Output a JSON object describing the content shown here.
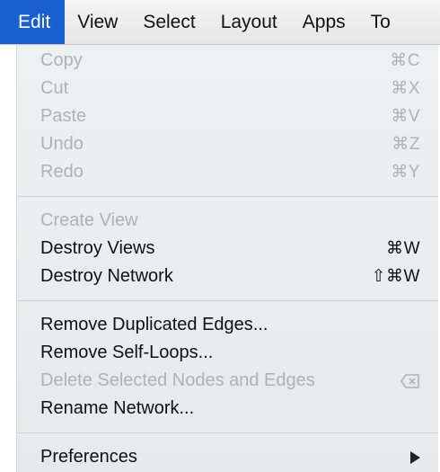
{
  "menubar": {
    "items": [
      {
        "label": "Edit"
      },
      {
        "label": "View"
      },
      {
        "label": "Select"
      },
      {
        "label": "Layout"
      },
      {
        "label": "Apps"
      },
      {
        "label": "To"
      }
    ]
  },
  "edit_menu": {
    "group1": [
      {
        "label": "Copy",
        "shortcut": "⌘C"
      },
      {
        "label": "Cut",
        "shortcut": "⌘X"
      },
      {
        "label": "Paste",
        "shortcut": "⌘V"
      },
      {
        "label": "Undo",
        "shortcut": "⌘Z"
      },
      {
        "label": "Redo",
        "shortcut": "⌘Y"
      }
    ],
    "group2": [
      {
        "label": "Create View"
      },
      {
        "label": "Destroy Views",
        "shortcut": "⌘W"
      },
      {
        "label": "Destroy Network",
        "shortcut": "⇧⌘W"
      }
    ],
    "group3": [
      {
        "label": "Remove Duplicated Edges..."
      },
      {
        "label": "Remove Self-Loops..."
      },
      {
        "label": "Delete Selected Nodes and Edges",
        "icon": "delete-key-icon"
      },
      {
        "label": "Rename Network..."
      }
    ],
    "group4": [
      {
        "label": "Preferences",
        "icon": "submenu-arrow-icon"
      }
    ]
  }
}
